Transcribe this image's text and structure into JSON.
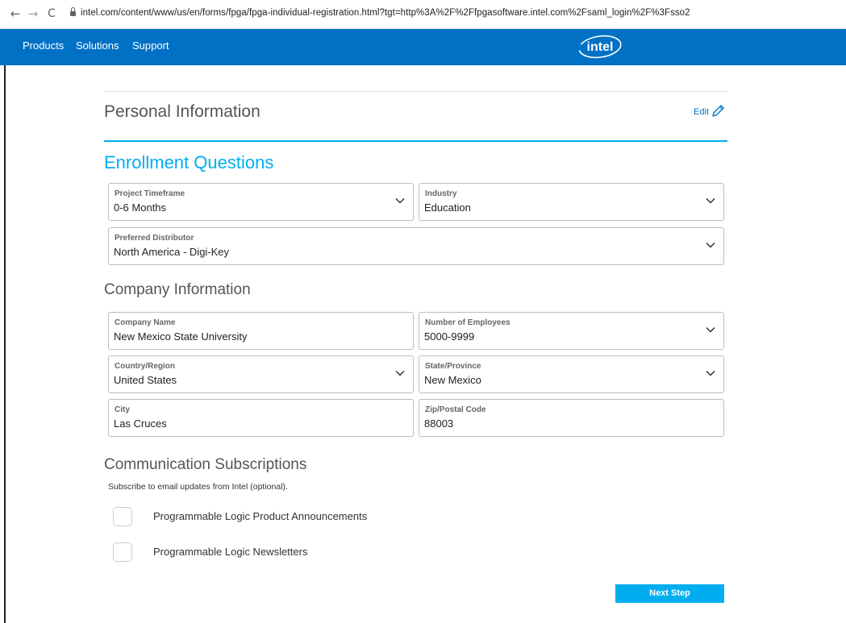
{
  "browser": {
    "url": "intel.com/content/www/us/en/forms/fpga/fpga-individual-registration.html?tgt=http%3A%2F%2Ffpgasoftware.intel.com%2Fsaml_login%2F%3Fsso2",
    "back_glyph": "←",
    "forward_glyph": "→",
    "reload_glyph": "C"
  },
  "header": {
    "nav": [
      "Products",
      "Solutions",
      "Support"
    ],
    "logo_text": "intel",
    "brand_color": "#0071c5"
  },
  "personal": {
    "title": "Personal Information",
    "edit_label": "Edit"
  },
  "enrollment": {
    "title": "Enrollment Questions",
    "project_timeframe": {
      "label": "Project Timeframe",
      "value": "0-6 Months"
    },
    "industry": {
      "label": "Industry",
      "value": "Education"
    },
    "preferred_distributor": {
      "label": "Preferred Distributor",
      "value": "North America - Digi-Key"
    }
  },
  "company": {
    "title": "Company Information",
    "company_name": {
      "label": "Company Name",
      "value": "New Mexico State University"
    },
    "number_of_employees": {
      "label": "Number of Employees",
      "value": "5000-9999"
    },
    "country_region": {
      "label": "Country/Region",
      "value": "United States"
    },
    "state_province": {
      "label": "State/Province",
      "value": "New Mexico"
    },
    "city": {
      "label": "City",
      "value": "Las Cruces"
    },
    "zip_postal_code": {
      "label": "Zip/Postal Code",
      "value": "88003"
    }
  },
  "subscriptions": {
    "title": "Communication Subscriptions",
    "description": "Subscribe to email updates from Intel (optional).",
    "options": [
      {
        "label": "Programmable Logic Product Announcements",
        "checked": false
      },
      {
        "label": "Programmable Logic Newsletters",
        "checked": false
      }
    ]
  },
  "actions": {
    "next_label": "Next Step",
    "accent_color": "#00aeef"
  }
}
